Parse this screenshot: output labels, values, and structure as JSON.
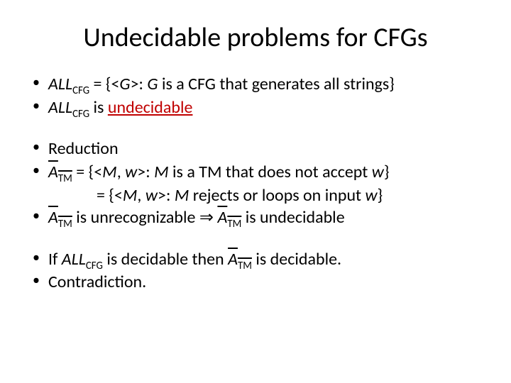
{
  "title": "Undecidable problems for CFGs",
  "lines": {
    "l1_pre": "ALL",
    "l1_sub": "CFG",
    "l1_mid": " = {<",
    "l1_g1": "G",
    "l1_mid2": ">: ",
    "l1_g2": "G",
    "l1_post": " is a CFG that generates all strings}",
    "l2_pre": "ALL",
    "l2_sub": "CFG",
    "l2_mid": " is ",
    "l2_undec": "undecidable",
    "l3": "Reduction",
    "l4_a": "A",
    "l4_tm": "TM",
    "l4_eq": " = {<",
    "l4_m1": "M",
    "l4_c1": ", ",
    "l4_w1": "w",
    "l4_mid": ">: ",
    "l4_m2": "M",
    "l4_txt": " is a TM that does not accept ",
    "l4_w2": "w",
    "l4_end": "}",
    "l5_eq": "= {<",
    "l5_m": "M",
    "l5_c": ", ",
    "l5_w": "w",
    "l5_mid": ">: ",
    "l5_m2": "M",
    "l5_txt": " rejects or loops on input ",
    "l5_w2": "w",
    "l5_end": "}",
    "l6_a": "A",
    "l6_tm": "TM",
    "l6_txt": " is unrecognizable ⇒ ",
    "l6_a2": "A",
    "l6_tm2": "TM",
    "l6_end": " is undecidable",
    "l7_pre": "If ",
    "l7_all": "ALL",
    "l7_sub": "CFG",
    "l7_mid": " is decidable then ",
    "l7_a": "A",
    "l7_tm": "TM",
    "l7_end": " is decidable.",
    "l8": "Contradiction."
  }
}
